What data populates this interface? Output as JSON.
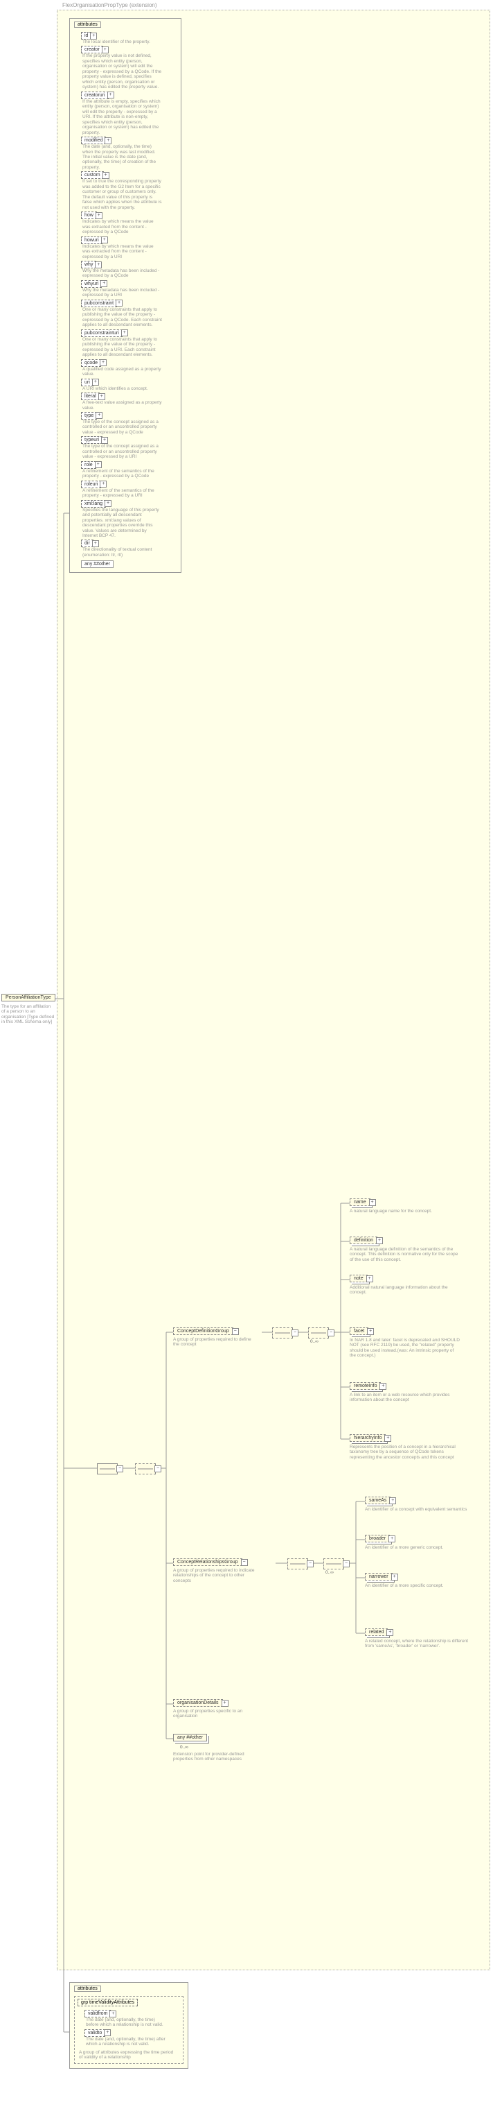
{
  "root": {
    "name": "PersonAffiliationType",
    "desc": "The type for an afflilation of a person to an organisation\n[Type defined in this XML Schema only]"
  },
  "extension": {
    "title": "FlexOrganisationPropType (extension)"
  },
  "attributes": {
    "title": "attributes",
    "items": [
      {
        "name": "id",
        "desc": "The local identifier of the property."
      },
      {
        "name": "creator",
        "desc": "If the property value is not defined, specifies which entity (person, organisation or system) will edit the property - expressed by a QCode. If the property value is defined, specifies which entity (person, organisation or system) has edited the property value."
      },
      {
        "name": "creatoruri",
        "desc": "If the attribute is empty, specifies which entity (person, organisation or system) will edit the property - expressed by a URI. If the attribute is non-empty, specifies which entity (person, organisation or system) has edited the property."
      },
      {
        "name": "modified",
        "desc": "The date (and, optionally, the time) when the property was last modified. The initial value is the date (and, optionally, the time) of creation of the property."
      },
      {
        "name": "custom",
        "desc": "If set to true the corresponding property was added to the G2 Item for a specific customer or group of customers only. The default value of this property is false which applies when the attribute is not used with the property."
      },
      {
        "name": "how",
        "desc": "Indicates by which means the value was extracted from the content - expressed by a QCode"
      },
      {
        "name": "howuri",
        "desc": "Indicates by which means the value was extracted from the content - expressed by a URI"
      },
      {
        "name": "why",
        "desc": "Why the metadata has been included - expressed by a QCode"
      },
      {
        "name": "whyuri",
        "desc": "Why the metadata has been included - expressed by a URI"
      },
      {
        "name": "pubconstraint",
        "desc": "One or many constraints that apply to publishing the value of the property - expressed by a QCode. Each constraint applies to all descendant elements."
      },
      {
        "name": "pubconstrainturi",
        "desc": "One or many constraints that apply to publishing the value of the property - expressed by a URI. Each constraint applies to all descendant elements."
      },
      {
        "name": "qcode",
        "desc": "A qualified code assigned as a property value."
      },
      {
        "name": "uri",
        "desc": "A URI which identifies a concept."
      },
      {
        "name": "literal",
        "desc": "A free-text value assigned as a property value."
      },
      {
        "name": "type",
        "desc": "The type of the concept assigned as a controlled or an uncontrolled property value - expressed by a QCode"
      },
      {
        "name": "typeuri",
        "desc": "The type of the concept assigned as a controlled or an uncontrolled property value - expressed by a URI"
      },
      {
        "name": "role",
        "desc": "A refinement of the semantics of the property - expressed by a QCode"
      },
      {
        "name": "roleuri",
        "desc": "A refinement of the semantics of the property - expressed by a URI"
      },
      {
        "name": "xml:lang",
        "desc": "Specifies the language of this property and potentially all descendant properties. xml:lang values of descendant properties override this value. Values are determined by Internet BCP 47."
      },
      {
        "name": "dir",
        "desc": "The directionality of textual content (enumeration: ltr, rtl)"
      }
    ],
    "any_other": "any ##other"
  },
  "conceptDefinitionGroup": {
    "name": "ConceptDefinitionGroup",
    "desc": "A group of properties required to define the concept",
    "items": [
      {
        "name": "name",
        "desc": "A natural language name for the concept."
      },
      {
        "name": "definition",
        "desc": "A natural language definition of the semantics of the concept. This definition is normative only for the scope of the use of this concept."
      },
      {
        "name": "note",
        "desc": "Additional natural language information about the concept."
      },
      {
        "name": "facet",
        "desc": "In NAR 1.8 and later: facet is deprecated and SHOULD NOT (see RFC 2119) be used, the \"related\" property should be used instead.(was: An intrinsic property of the concept.)"
      },
      {
        "name": "remoteInfo",
        "desc": "A link to an item or a web resource which provides information about the concept"
      },
      {
        "name": "hierarchyInfo",
        "desc": "Represents the position of a concept in a hierarchical taxonomy tree by a sequence of QCode tokens representing the ancestor concepts and this concept"
      }
    ]
  },
  "conceptRelationshipsGroup": {
    "name": "ConceptRelationshipsGroup",
    "desc": "A group of properties required to indicate relationships of the concept to other concepts",
    "items": [
      {
        "name": "sameAs",
        "desc": "An identifier of a concept with equivalent semantics"
      },
      {
        "name": "broader",
        "desc": "An identifier of a more generic concept."
      },
      {
        "name": "narrower",
        "desc": "An identifier of a more specific concept."
      },
      {
        "name": "related",
        "desc": "A related concept, where the relationship is different from 'sameAs', 'broader' or 'narrower'."
      }
    ]
  },
  "orgDetails": {
    "name": "organisationDetails",
    "desc": "A group of properties specific to an organisation"
  },
  "anyOther": {
    "name": "any ##other",
    "desc": "Extension point for provider-defined properties from other namespaces"
  },
  "timeValidity": {
    "grp_title": "grp timeValidityAttributes",
    "title": "attributes",
    "items": [
      {
        "name": "validfrom",
        "desc": "The date (and, optionally, the time) before which a relationship is not valid."
      },
      {
        "name": "validto",
        "desc": "The date (and, optionally, the time) after which a relationship is not valid."
      }
    ],
    "group_desc": "A group of attributes expressing the time period of validity of a relationship"
  },
  "occurs": "0..∞"
}
